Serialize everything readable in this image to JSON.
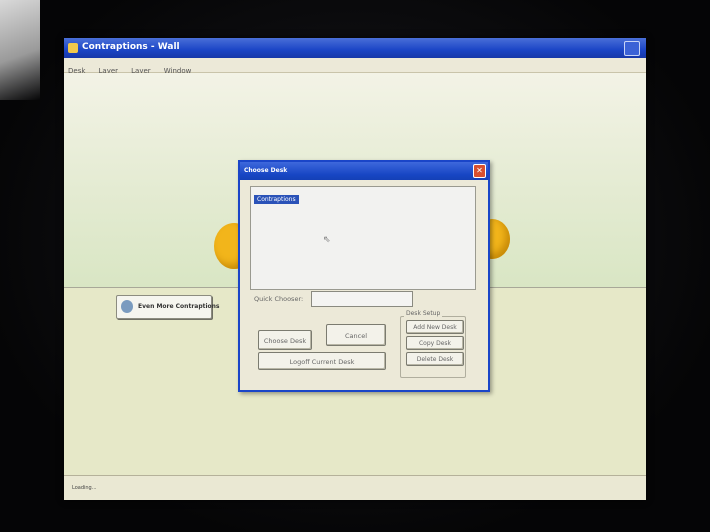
{
  "app_window": {
    "title": "Contraptions - Wall",
    "menu": [
      "Desk",
      "Layer",
      "Layer",
      "Window"
    ],
    "side_button_label": "Even More Contraptions",
    "status_text": "Loading..."
  },
  "dialog": {
    "title": "Choose Desk",
    "close_glyph": "✕",
    "list_items": [
      "Contraptions"
    ],
    "quick_chooser_label": "Quick Chooser:",
    "quick_chooser_value": "",
    "choose_label": "Choose Desk",
    "cancel_label": "Cancel",
    "logoff_label": "Logoff Current Desk",
    "desk_setup_label": "Desk Setup",
    "add_label": "Add New Desk",
    "copy_label": "Copy Desk",
    "delete_label": "Delete Desk"
  },
  "colors": {
    "titlebar_blue": "#1b45c6",
    "dialog_bg": "#ece9d8",
    "selection": "#2a52b8"
  },
  "icons": {
    "app": "app-icon",
    "maximize": "maximize-icon",
    "close": "close-icon",
    "cursor": "mouse-cursor-icon",
    "side_button": "contraption-icon"
  }
}
